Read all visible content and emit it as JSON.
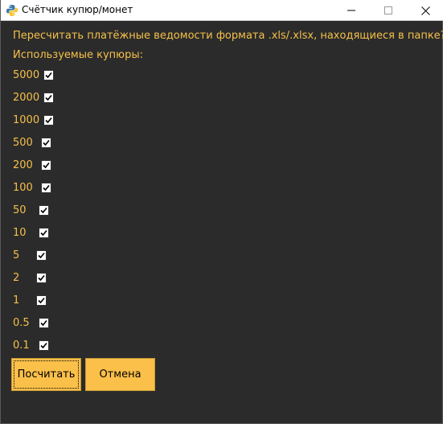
{
  "window": {
    "title": "Счётчик купюр/монет",
    "controls": {
      "minimize": "—",
      "maximize": "□",
      "close": "✕"
    }
  },
  "content": {
    "question": "Пересчитать платёжные ведомости формата .xls/.xlsx, находящиеся в папке?",
    "used_denominations_label": "Используемые купюры:",
    "denominations": [
      {
        "value": "5000",
        "checked": true
      },
      {
        "value": "2000",
        "checked": true
      },
      {
        "value": "1000",
        "checked": true
      },
      {
        "value": "500",
        "checked": true
      },
      {
        "value": "200",
        "checked": true
      },
      {
        "value": "100",
        "checked": true
      },
      {
        "value": "50",
        "checked": true
      },
      {
        "value": "10",
        "checked": true
      },
      {
        "value": "5",
        "checked": true
      },
      {
        "value": "2",
        "checked": true
      },
      {
        "value": "1",
        "checked": true
      },
      {
        "value": "0.5",
        "checked": true
      },
      {
        "value": "0.1",
        "checked": true
      }
    ]
  },
  "buttons": {
    "count_label": "Посчитать",
    "cancel_label": "Отмена"
  },
  "colors": {
    "background": "#2b2b2b",
    "text": "#f5c04a",
    "button": "#fbc04a"
  }
}
